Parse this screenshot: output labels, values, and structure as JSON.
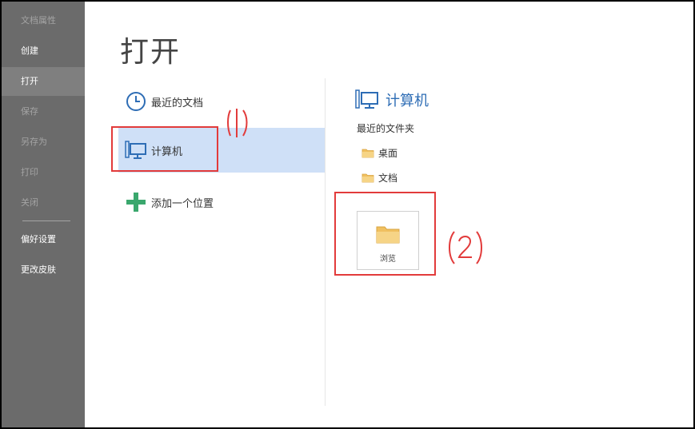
{
  "sidebar": {
    "items": [
      {
        "label": "文档属性"
      },
      {
        "label": "创建"
      },
      {
        "label": "打开"
      },
      {
        "label": "保存"
      },
      {
        "label": "另存为"
      },
      {
        "label": "打印"
      },
      {
        "label": "关闭"
      },
      {
        "label": "偏好设置"
      },
      {
        "label": "更改皮肤"
      }
    ]
  },
  "main": {
    "title": "打开",
    "places": [
      {
        "label": "最近的文档",
        "icon": "clock-icon"
      },
      {
        "label": "计算机",
        "icon": "computer-icon"
      },
      {
        "label": "添加一个位置",
        "icon": "plus-icon"
      }
    ]
  },
  "right": {
    "title": "计算机",
    "recent_label": "最近的文件夹",
    "folders": [
      {
        "label": "桌面",
        "icon": "folder-icon"
      },
      {
        "label": "文档",
        "icon": "folder-icon"
      }
    ],
    "browse_label": "浏览"
  },
  "colors": {
    "sidebar_bg": "#6b6b6b",
    "selected_bg": "#cfe0f7",
    "accent_blue": "#2e6db5",
    "annotation_red": "#e23b3b",
    "plus_green": "#3aa76d",
    "folder_yellow": "#f0c060"
  }
}
